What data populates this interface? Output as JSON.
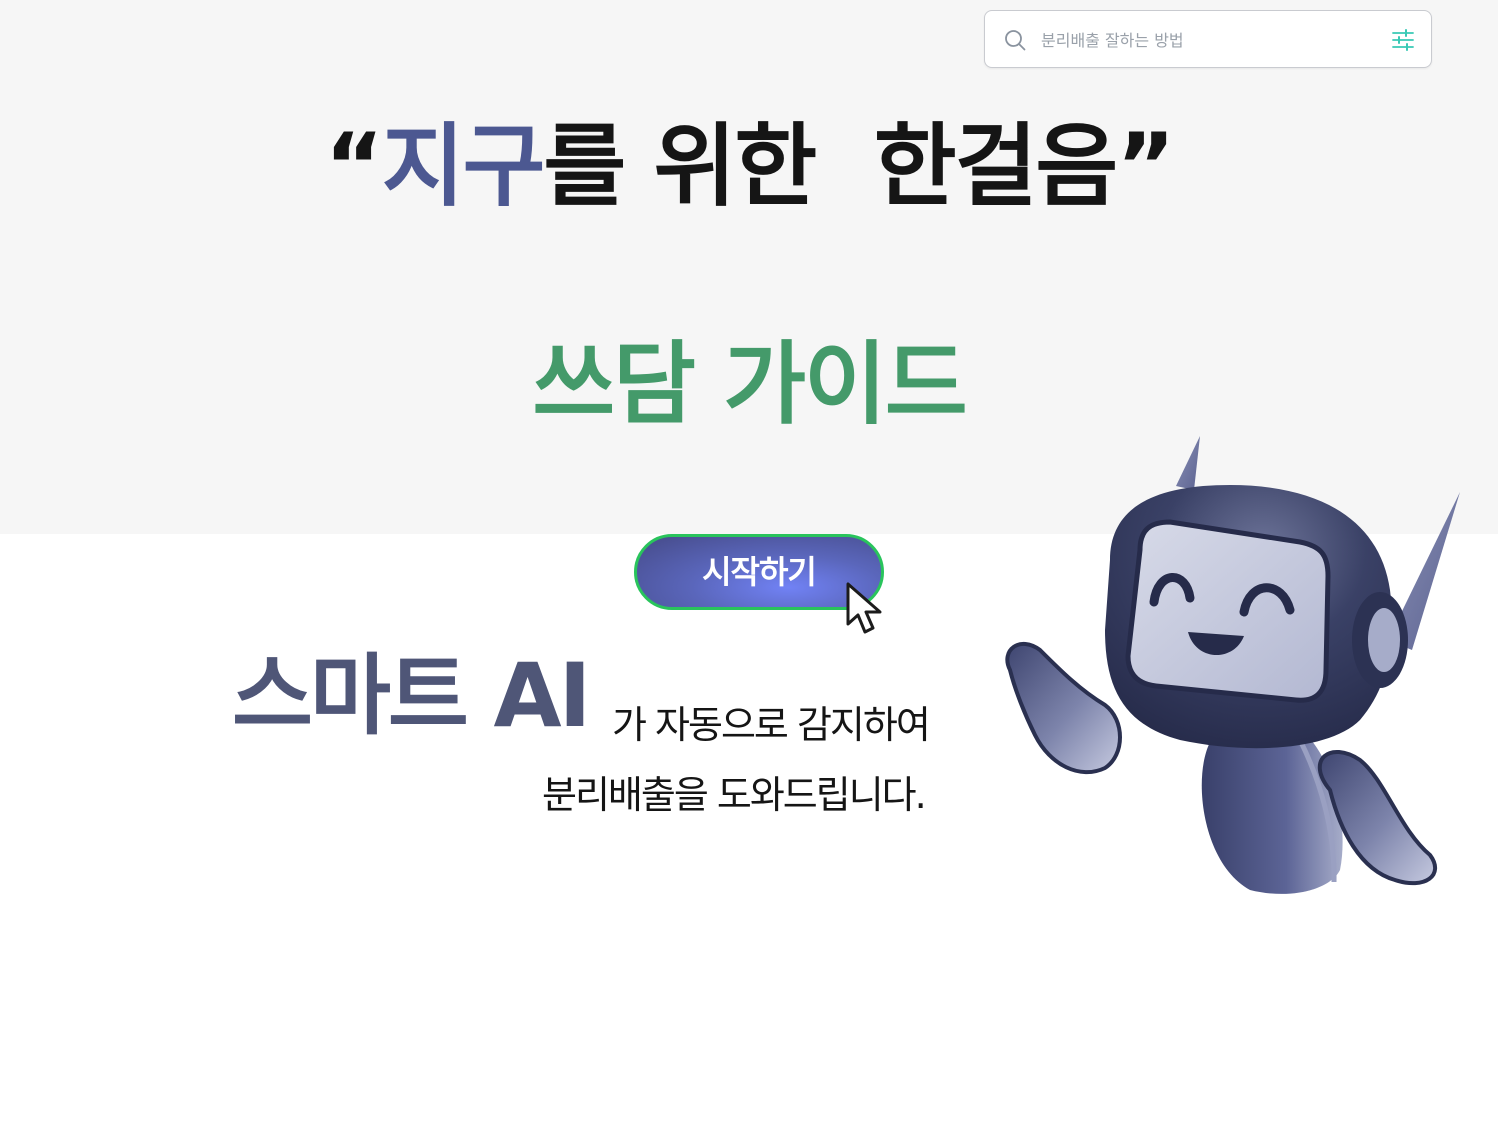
{
  "search": {
    "placeholder": "분리배출 잘하는 방법",
    "search_icon": "search-icon",
    "filter_icon": "sliders-icon"
  },
  "hero": {
    "quote_open": "“",
    "accent": "지구",
    "rest": "를 위한  한걸음",
    "quote_close": "”",
    "guide_title": "쓰담 가이드"
  },
  "cta": {
    "start_label": "시작하기",
    "cursor_icon": "mouse-pointer-icon"
  },
  "intro": {
    "highlight": "스마트 AI",
    "suffix": "가 자동으로 감지하여",
    "line2": "분리배출을 도와드립니다."
  },
  "mascot": {
    "icon": "robot-mascot-icon"
  },
  "colors": {
    "accent_navy": "#4c5891",
    "guide_green": "#449a6a",
    "button_border": "#29c45c",
    "button_fill": "#5a66bb",
    "hero_bg": "#f6f6f6",
    "filter_icon": "#39c9b5"
  }
}
